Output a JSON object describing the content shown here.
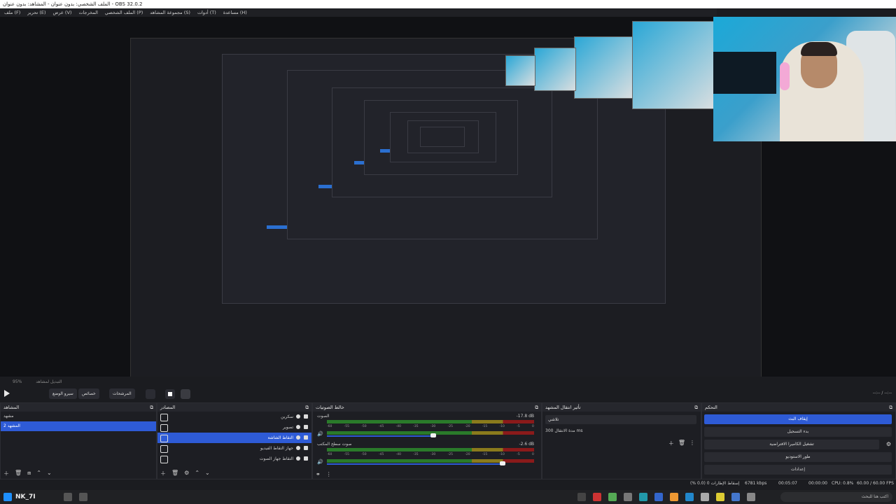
{
  "window": {
    "title": "الملف الشخصي: بدون عنوان - المشاهد: بدون عنوان - OBS 32.0.2"
  },
  "menu": [
    "ملف (F)",
    "تحرير (E)",
    "عرض (V)",
    "المخرجات",
    "الملف الشخصي (P)",
    "مجموعة المشاهد (S)",
    "أدوات (T)",
    "مساعدة (H)"
  ],
  "controls": {
    "zoom": "95%",
    "scene_toggle": "التبديل لمشاهد",
    "studio": "سيرو الوضع",
    "filters": "المرشحات",
    "properties": "خصائص",
    "arrows": "--:-- / --:--"
  },
  "scenes": {
    "title": "المشاهد",
    "items": [
      "مشهد",
      "المشهد 2"
    ],
    "selected": 1
  },
  "sources": {
    "title": "المصادر",
    "items": [
      "سكرين",
      "تصوير",
      "التقاط الشاشة",
      "جهاز التقاط الفيديو",
      "التقاط جهاز الصوت"
    ],
    "selected": 2
  },
  "mixer": {
    "title": "خالط الصوتيات",
    "ch1": {
      "name": "الصوت",
      "db": "-17.8 dB"
    },
    "ch2": {
      "name": "صوت سطح المكتب",
      "db": "-2.6 dB"
    },
    "ticks": [
      "-60",
      "-55",
      "-50",
      "-45",
      "-40",
      "-35",
      "-30",
      "-25",
      "-20",
      "-15",
      "-10",
      "-5",
      "0"
    ]
  },
  "transitions": {
    "title": "تأثير انتقال المشهد",
    "selected": "تلاشي",
    "duration_label": "مدة الانتقال",
    "duration": "300 ms"
  },
  "control_dock": {
    "title": "التحكم",
    "buttons": [
      "إيقاف البث",
      "بدء التسجيل",
      "تشغيل الكاميرا الافتراضية",
      "طور الاستوديو",
      "إعدادات"
    ]
  },
  "status": {
    "dropped": "إسقاط الإطارات 0 (0.0 %)",
    "kbps": "6781 kbps",
    "time1": "00:05:07",
    "time2": "00:00:00",
    "cpu": "CPU: 0.8%",
    "fps": "60.00 / 60.00 FPS"
  },
  "taskbar": {
    "user": "NK_7I",
    "search": "اكتب هنا للبحث"
  }
}
